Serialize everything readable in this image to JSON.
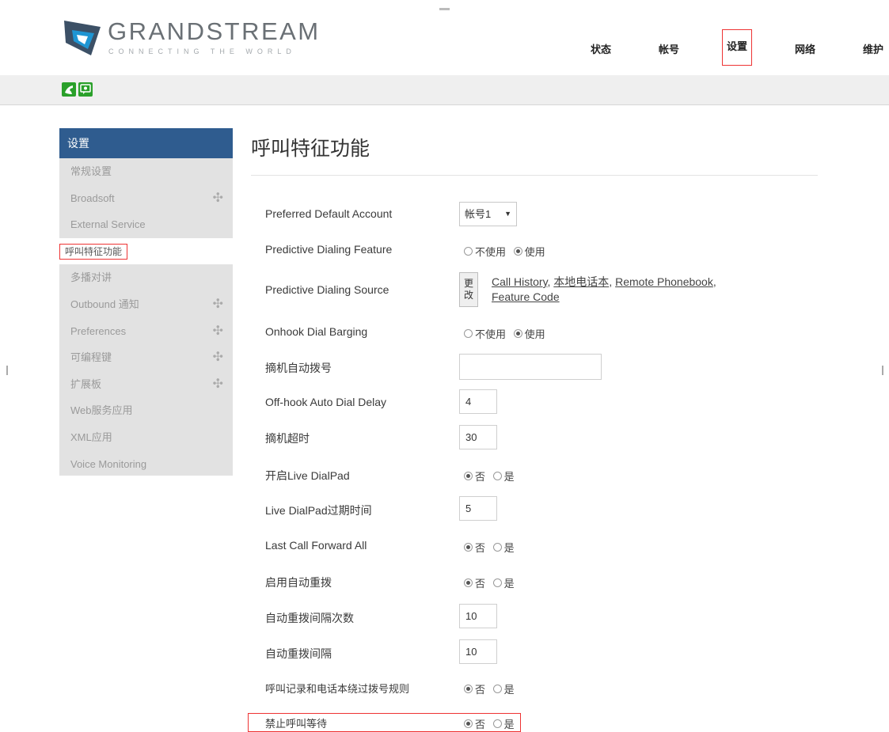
{
  "header": {
    "brand_name": "GRANDSTREAM",
    "brand_tagline": "CONNECTING THE WORLD",
    "nav": [
      {
        "label": "状态",
        "active": false
      },
      {
        "label": "帐号",
        "active": false
      },
      {
        "label": "设置",
        "active": true
      },
      {
        "label": "网络",
        "active": false
      },
      {
        "label": "维护",
        "active": false
      }
    ]
  },
  "toolbar": {
    "icons": [
      "phone-icon",
      "chat-icon"
    ],
    "colors": {
      "icon_bg": "#2aa02a"
    }
  },
  "sidebar": {
    "header": "设置",
    "items": [
      {
        "label": "常规设置",
        "has_plus": false,
        "current": false
      },
      {
        "label": "Broadsoft",
        "has_plus": true,
        "current": false
      },
      {
        "label": "External Service",
        "has_plus": false,
        "current": false
      },
      {
        "label": "呼叫特征功能",
        "has_plus": false,
        "current": true
      },
      {
        "label": "多播对讲",
        "has_plus": false,
        "current": false
      },
      {
        "label": "Outbound 通知",
        "has_plus": true,
        "current": false
      },
      {
        "label": "Preferences",
        "has_plus": true,
        "current": false
      },
      {
        "label": "可编程键",
        "has_plus": true,
        "current": false
      },
      {
        "label": "扩展板",
        "has_plus": true,
        "current": false
      },
      {
        "label": "Web服务应用",
        "has_plus": false,
        "current": false
      },
      {
        "label": "XML应用",
        "has_plus": false,
        "current": false
      },
      {
        "label": "Voice Monitoring",
        "has_plus": false,
        "current": false
      }
    ],
    "plus_glyph": "✣",
    "colors": {
      "header_bg": "#2f5c8f",
      "bg": "#e2e2e2"
    }
  },
  "main": {
    "title": "呼叫特征功能",
    "radio_labels": {
      "disable": "不使用",
      "enable": "使用",
      "no": "否",
      "yes": "是"
    },
    "settings": {
      "preferred_default_account": {
        "label": "Preferred Default Account",
        "value": "帐号1",
        "arrow": "▼"
      },
      "predictive_dialing_feature": {
        "label": "Predictive Dialing Feature",
        "selected": "使用"
      },
      "predictive_dialing_source": {
        "label": "Predictive Dialing Source",
        "change_button": {
          "line1": "更",
          "line2": "改"
        },
        "sources": [
          "Call History",
          "本地电话本",
          "Remote Phonebook",
          "Feature Code"
        ],
        "separator": ", "
      },
      "onhook_dial_barging": {
        "label": "Onhook Dial Barging",
        "selected": "使用"
      },
      "offhook_auto_dial": {
        "label": "摘机自动拨号",
        "value": ""
      },
      "offhook_auto_dial_delay": {
        "label": "Off-hook Auto Dial Delay",
        "value": "4"
      },
      "offhook_timeout": {
        "label": "摘机超时",
        "value": "30"
      },
      "enable_live_dialpad": {
        "label": "开启Live DialPad",
        "selected": "否"
      },
      "live_dialpad_expire": {
        "label": "Live DialPad过期时间",
        "value": "5"
      },
      "last_call_forward_all": {
        "label": "Last Call Forward All",
        "selected": "否"
      },
      "enable_auto_redial": {
        "label": "启用自动重拨",
        "selected": "否"
      },
      "auto_redial_times": {
        "label": "自动重拨间隔次数",
        "value": "10"
      },
      "auto_redial_interval": {
        "label": "自动重拨间隔",
        "value": "10"
      },
      "bypass_dial_plan": {
        "label": "呼叫记录和电话本绕过拨号规则",
        "selected": "否"
      },
      "disable_call_waiting": {
        "label": "禁止呼叫等待",
        "selected": "否"
      }
    }
  },
  "colors": {
    "highlight": "#e33333",
    "link": "#444444"
  }
}
